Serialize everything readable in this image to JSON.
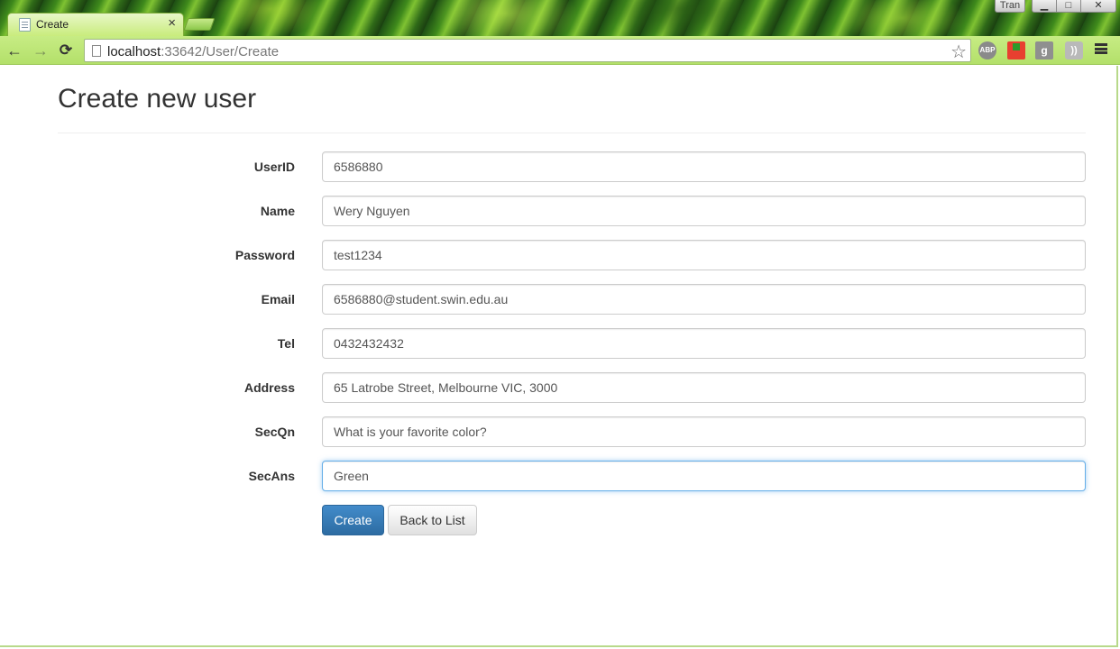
{
  "browser": {
    "tab_title": "Create",
    "tab_close": "×",
    "user_badge": "Tran",
    "window_controls": {
      "minimize": "▁",
      "maximize": "□",
      "close": "✕"
    },
    "address": {
      "host": "localhost",
      "path": ":33642/User/Create"
    },
    "nav": {
      "back": "←",
      "forward": "→",
      "reload": "⟳",
      "star": "☆"
    },
    "extensions": {
      "abp": "ABP",
      "gplus": "g",
      "rss": "))"
    }
  },
  "page": {
    "title": "Create new user",
    "fields": [
      {
        "label": "UserID",
        "value": "6586880"
      },
      {
        "label": "Name",
        "value": "Wery Nguyen"
      },
      {
        "label": "Password",
        "value": "test1234"
      },
      {
        "label": "Email",
        "value": "6586880@student.swin.edu.au"
      },
      {
        "label": "Tel",
        "value": "0432432432"
      },
      {
        "label": "Address",
        "value": "65 Latrobe Street, Melbourne VIC, 3000"
      },
      {
        "label": "SecQn",
        "value": "What is your favorite color?"
      },
      {
        "label": "SecAns",
        "value": "Green"
      }
    ],
    "create_label": "Create",
    "back_label": "Back to List"
  }
}
